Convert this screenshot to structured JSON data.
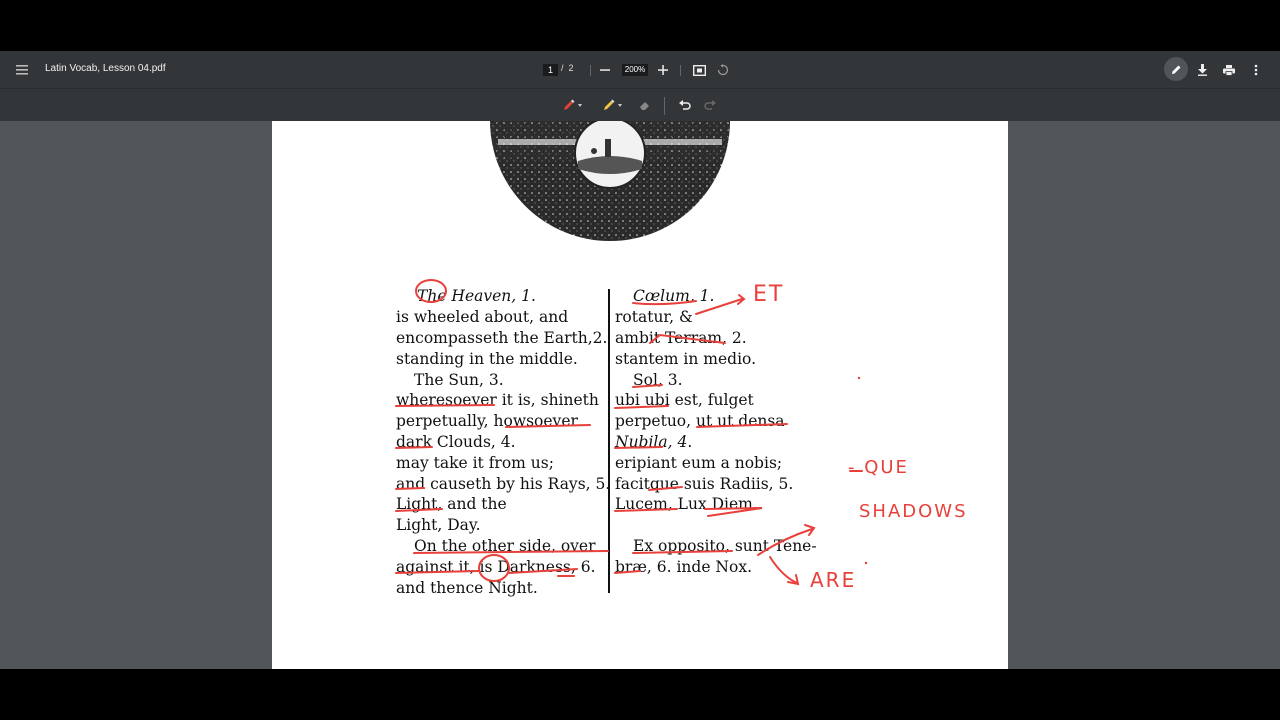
{
  "toolbar": {
    "file_title": "Latin Vocab, Lesson 04.pdf",
    "current_page": "1",
    "page_separator": "/",
    "total_pages": "2",
    "zoom": "200%",
    "icons": [
      "menu-icon",
      "zoom-out-icon",
      "zoom-in-icon",
      "fit-page-icon",
      "rotate-icon",
      "annotate-pen-icon",
      "download-icon",
      "print-icon",
      "more-icon"
    ]
  },
  "annotation_tools": {
    "icons": [
      "pen-tool-icon",
      "highlighter-tool-icon",
      "eraser-icon",
      "undo-icon",
      "redo-icon"
    ],
    "pen_color": "#e8413b",
    "highlighter_color": "#f4c542"
  },
  "document": {
    "left_lines": [
      "The Heaven, 1.",
      "is wheeled about, and",
      "encompasseth the Earth,2.",
      "standing in the middle.",
      "The Sun, 3.",
      "wheresoever it is, shineth",
      "perpetually,  howsoever",
      "dark Clouds, 4.",
      "may take it from us;",
      "and causeth by his Rays, 5.",
      "Light, and the",
      "Light, Day.",
      "On the other side, over",
      "against it, is Darkness, 6.",
      "and thence Night."
    ],
    "right_lines": [
      "Cœlum, 1.",
      "rotatur, &",
      "ambit Terram, 2.",
      "stantem in medio.",
      "Sol, 3.",
      "ubi ubi est, fulget",
      "perpetuo, ut ut densa",
      "Nubila, 4.",
      "eripiant eum a nobis;",
      "facitque suis Radiis, 5.",
      "Lucem, Lux Diem.",
      "Ex opposito, sunt Tene-",
      "bræ, 6. inde Nox."
    ],
    "annotations": [
      "ET",
      "- QUE",
      "SHADOWS",
      "ARE"
    ]
  },
  "colors": {
    "toolbar_bg": "#323639",
    "viewer_bg": "#525659",
    "annotation_red": "#e8413b"
  }
}
